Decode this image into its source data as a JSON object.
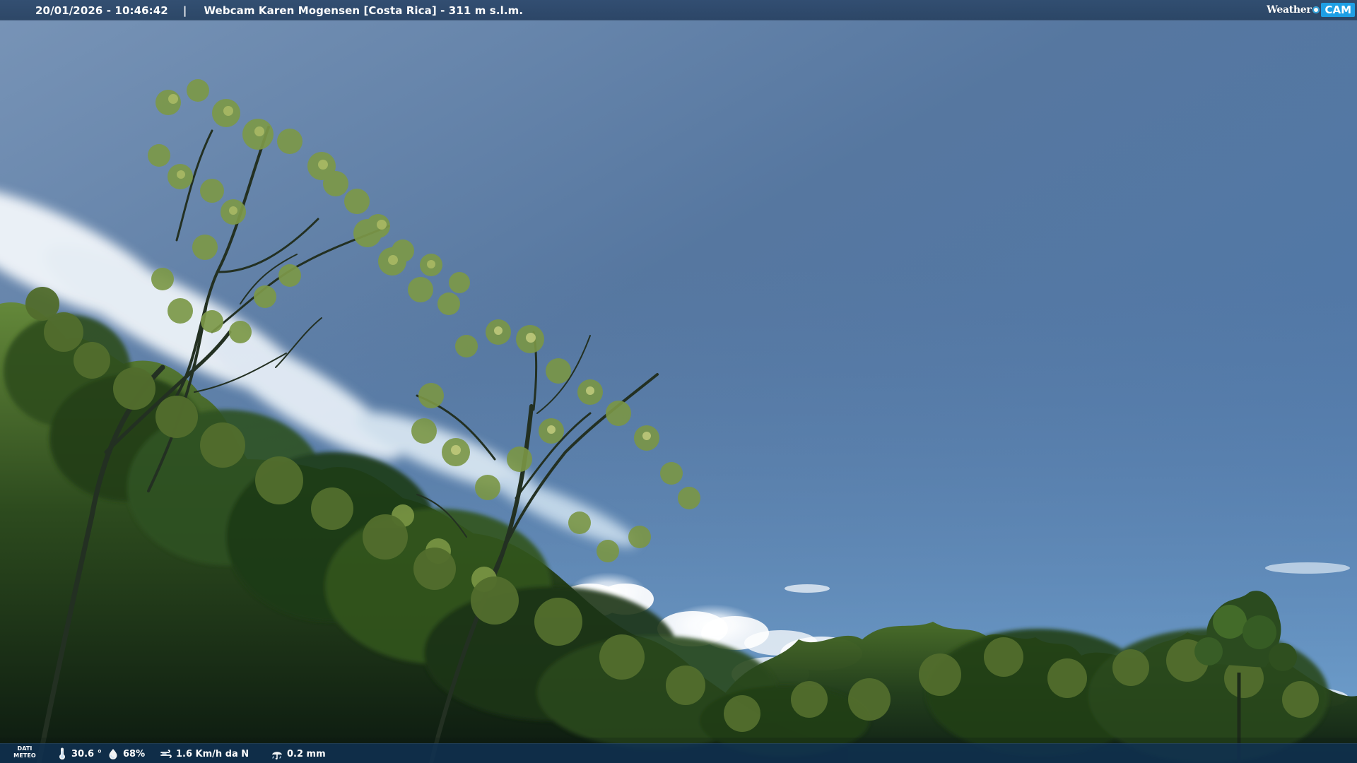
{
  "header": {
    "datetime": "20/01/2026 - 10:46:42",
    "separator": "|",
    "title": "Webcam Karen Mogensen [Costa Rica] - 311 m s.l.m."
  },
  "brand": {
    "weather": "Weather",
    "cam": "CAM"
  },
  "meteo": {
    "label_top": "DATI",
    "label_bottom": "METEO",
    "temperature": "30.6 °",
    "humidity": "68%",
    "wind": "1.6 Km/h da N",
    "rain": "0.2 mm",
    "icons": [
      "thermometer-icon",
      "humidity-icon",
      "wind-icon",
      "rain-icon"
    ]
  },
  "colors": {
    "top_bar": "#2f4c70",
    "bottom_bar": "#103254",
    "brand_blue": "#1e9fe5",
    "sky_top": "#506f96",
    "sky_bottom": "#6f9fce",
    "foliage_dark": "#102514",
    "foliage_light": "#7d9a47"
  }
}
